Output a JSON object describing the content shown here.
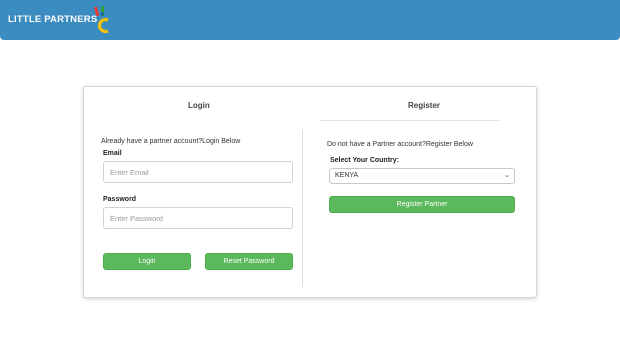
{
  "navbar": {
    "brand": "LITTLE PARTNERS",
    "logo_icon": "little-logo-icon"
  },
  "tabs": {
    "login": "Login",
    "register": "Register"
  },
  "login": {
    "intro": "Already have a partner account?Login Below",
    "email_label": "Email",
    "email_placeholder": "Enter Email",
    "password_label": "Password",
    "password_placeholder": "Enter Password",
    "login_button": "Login",
    "reset_button": "Reset Password"
  },
  "register": {
    "intro": "Do not have a Partner account?Register Below",
    "country_label": "Select Your Country:",
    "country_value": "KENYA",
    "register_button": "Register Partner"
  },
  "colors": {
    "navbar": "#3a8cc1",
    "button": "#5cb85c"
  }
}
